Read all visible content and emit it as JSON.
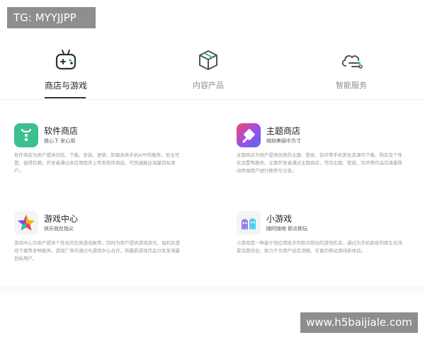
{
  "watermark_top": "TG: MYYJJPP",
  "watermark_bottom": "www.h5baijiale.com",
  "tabs": [
    {
      "label": "商店与游戏",
      "icon": "gamepad-icon"
    },
    {
      "label": "内容产品",
      "icon": "box-icon"
    },
    {
      "label": "智能服务",
      "icon": "cloud-service-icon"
    }
  ],
  "cards": [
    {
      "title": "软件商店",
      "subtitle": "放心下 安心用",
      "desc": "软件商店为用户提供浏览、下载、安装、更新、卸载各类手机APP的服务，安全可靠，值得信赖。开发者通过本应用程序上传至软件商店，可快速触达海量目标用户。",
      "icon": "software-store-icon",
      "color": "#3dbf8e"
    },
    {
      "title": "主题商店",
      "subtitle": "缤纷美丽中方寸",
      "desc": "主题商店为用户提供优质的主题、壁纸、铃声等手机美化资源的下载、购买及个性化设置等服务。主题开发者通过主题商店，可向主题、壁纸、铃声等作品向海量移动终端用户进行推荐与分发。",
      "icon": "theme-store-icon",
      "color": "#6d5be8"
    },
    {
      "title": "游戏中心",
      "subtitle": "快乐就在指尖",
      "desc": "游戏中心为用户提供个性化的优质游戏推荐，同时为用户提供游戏资讯、福利及游戏下载等多种服务。游戏厂商可通过与游戏中心合作，将最新游戏作品分发至海量目标用户。",
      "icon": "game-center-icon",
      "color": "#f0405a"
    },
    {
      "title": "小游戏",
      "subtitle": "随时随地 即点即玩",
      "desc": "小游戏是一种基于快应用技术的即点即玩的游戏形态，通过为手机系统的原生化场景深度结合，致力于为用户创造流畅、丰富的移动游戏新体验。",
      "icon": "mini-game-icon",
      "color": "#9b7cf2"
    }
  ]
}
